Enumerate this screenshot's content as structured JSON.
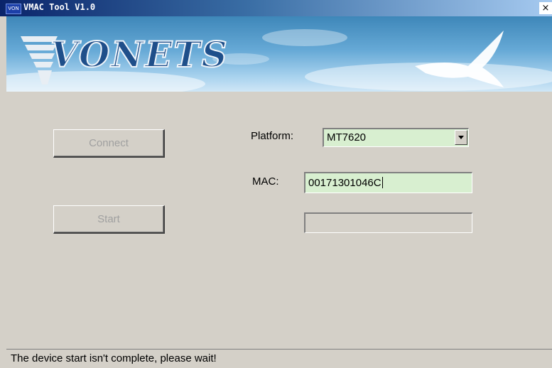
{
  "window": {
    "title": "VMAC Tool V1.0",
    "icon": "app-icon",
    "close_label": "×"
  },
  "banner": {
    "logo_text": "VONETS"
  },
  "buttons": {
    "connect_label": "Connect",
    "start_label": "Start"
  },
  "form": {
    "platform_label": "Platform:",
    "platform_value": "MT7620",
    "mac_label": "MAC:",
    "mac_value": "00171301046C",
    "progress_value": ""
  },
  "status": {
    "text": "The device start isn't complete, please wait!"
  },
  "colors": {
    "field_bg": "#d8efd0",
    "face": "#d4d0c8",
    "titlebar": "#0a246a"
  }
}
